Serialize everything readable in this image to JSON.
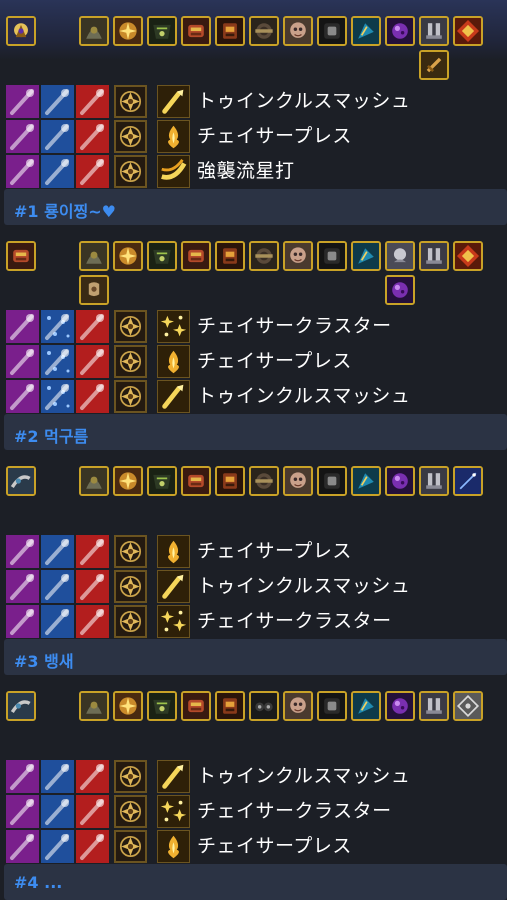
{
  "builds": [
    {
      "rank_label": "#1 룡이찡~♥",
      "skills": [
        {
          "name": "トゥインクルスマッシュ",
          "icon": "twinkle-smash-icon"
        },
        {
          "name": "チェイサープレス",
          "icon": "chaser-press-icon"
        },
        {
          "name": "強襲流星打",
          "icon": "assault-meteor-strike-icon"
        }
      ],
      "talent_columns": [
        "purple-talent",
        "blue-talent",
        "red-talent"
      ],
      "rune_icon": "gold-rune-icon"
    },
    {
      "rank_label": "#2 먹구름",
      "skills": [
        {
          "name": "チェイサークラスター",
          "icon": "chaser-cluster-icon"
        },
        {
          "name": "チェイサープレス",
          "icon": "chaser-press-icon"
        },
        {
          "name": "トゥインクルスマッシュ",
          "icon": "twinkle-smash-icon"
        }
      ],
      "talent_columns": [
        "purple-talent",
        "blue-talent",
        "red-talent"
      ],
      "rune_icon": "gold-rune-icon"
    },
    {
      "rank_label": "#3 뱅새",
      "skills": [
        {
          "name": "チェイサープレス",
          "icon": "chaser-press-icon"
        },
        {
          "name": "トゥインクルスマッシュ",
          "icon": "twinkle-smash-icon"
        },
        {
          "name": "チェイサークラスター",
          "icon": "chaser-cluster-icon"
        }
      ],
      "talent_columns": [
        "purple-talent",
        "blue-talent",
        "red-talent"
      ],
      "rune_icon": "gold-rune-icon"
    },
    {
      "rank_label": "#4 ...",
      "skills": [
        {
          "name": "トゥインクルスマッシュ",
          "icon": "twinkle-smash-icon"
        },
        {
          "name": "チェイサークラスター",
          "icon": "chaser-cluster-icon"
        },
        {
          "name": "チェイサープレス",
          "icon": "chaser-press-icon"
        }
      ],
      "talent_columns": [
        "purple-talent",
        "blue-talent",
        "red-talent"
      ],
      "rune_icon": "gold-rune-icon"
    }
  ],
  "colors": {
    "background": "#1c1f26",
    "footer_bg": "#2b3344",
    "rank_text": "#3d8cf0",
    "gold_border": "#c9a227",
    "talent_purple": "#7a1f8c",
    "talent_blue": "#1f4f9c",
    "talent_red": "#b31e1e"
  }
}
